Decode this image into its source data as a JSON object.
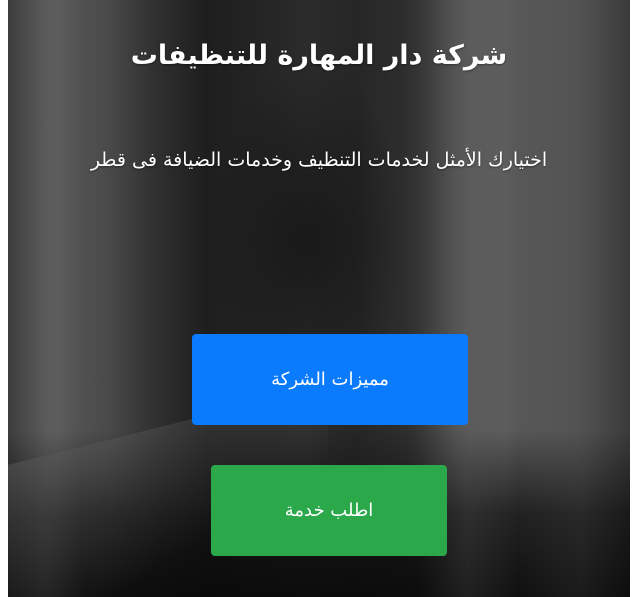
{
  "hero": {
    "title": "شركة دار المهارة للتنظيفات",
    "subtitle": "اختيارك الأمثل لخدمات التنظيف وخدمات الضيافة فى قطر"
  },
  "buttons": {
    "features_label": "مميزات الشركة",
    "request_label": "اطلب خدمة"
  },
  "colors": {
    "features_button": "#0b7bfe",
    "request_button": "#2aa84a",
    "text": "#ffffff"
  }
}
